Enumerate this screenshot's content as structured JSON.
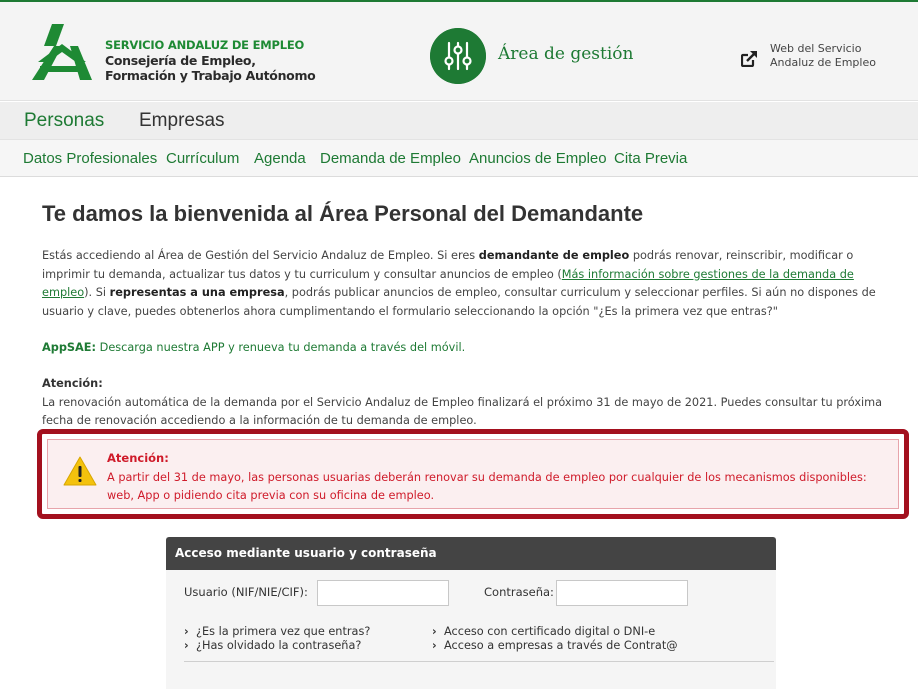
{
  "header": {
    "org_title": "SERVICIO ANDALUZ DE EMPLEO",
    "org_sub_line1": "Consejería de Empleo,",
    "org_sub_line2": "Formación y Trabajo Autónomo",
    "area_title": "Área de gestión",
    "web_link_line1": "Web del Servicio",
    "web_link_line2": "Andaluz de Empleo",
    "icons": {
      "logo": "junta-andalucia-logo",
      "area": "sliders-icon",
      "external": "external-link-icon"
    },
    "colors": {
      "brand_green": "#1e7a34",
      "alert_red": "#a3101e"
    }
  },
  "nav_primary": [
    {
      "label": "Personas",
      "active": true
    },
    {
      "label": "Empresas",
      "active": false
    }
  ],
  "nav_secondary": [
    {
      "label": "Datos Profesionales"
    },
    {
      "label": "Currículum"
    },
    {
      "label": "Agenda"
    },
    {
      "label": "Demanda de Empleo"
    },
    {
      "label": "Anuncios de Empleo"
    },
    {
      "label": "Cita Previa"
    }
  ],
  "main": {
    "title": "Te damos la bienvenida al Área Personal del Demandante",
    "intro": {
      "t1": "Estás accediendo al Área de Gestión del Servicio Andaluz de Empleo. Si eres ",
      "b1": "demandante de empleo",
      "t2": " podrás renovar, reinscribir, modificar o imprimir tu demanda, actualizar tus datos y tu curriculum y consultar anuncios de empleo (",
      "link": "Más información sobre gestiones de la demanda de empleo",
      "t3": "). Si ",
      "b2": "representas a una empresa",
      "t4": ", podrás publicar anuncios de empleo, consultar curriculum y seleccionar perfiles. Si aún no dispones de usuario y clave, puedes obtenerlos ahora cumplimentando el formulario seleccionando la opción \"¿Es la primera vez que entras?\""
    },
    "appsae": {
      "label": "AppSAE:",
      "text": " Descarga nuestra APP y renueva tu demanda a través del móvil."
    },
    "notice": {
      "label": "Atención:",
      "text": "La renovación automática de la demanda por el Servicio Andaluz de Empleo finalizará el próximo 31 de mayo de 2021. Puedes consultar tu próxima fecha de renovación accediendo a la información de tu demanda de empleo."
    }
  },
  "alert": {
    "icon": "warning-icon",
    "title": "Atención:",
    "text": "A partir del 31 de mayo, las personas usuarias deberán renovar su demanda de empleo por cualquier de los mecanismos disponibles: web, App o pidiendo cita previa con su oficina de empleo."
  },
  "login": {
    "heading": "Acceso mediante usuario y contraseña",
    "user_label": "Usuario (NIF/NIE/CIF):",
    "user_value": "",
    "pass_label": "Contraseña:",
    "pass_value": "",
    "links": {
      "first_time": "¿Es la primera vez que entras?",
      "forgot": "¿Has olvidado la contraseña?",
      "certificate": "Acceso con certificado digital o DNI-e",
      "contrata": "Acceso a empresas a través de Contrat@"
    }
  }
}
